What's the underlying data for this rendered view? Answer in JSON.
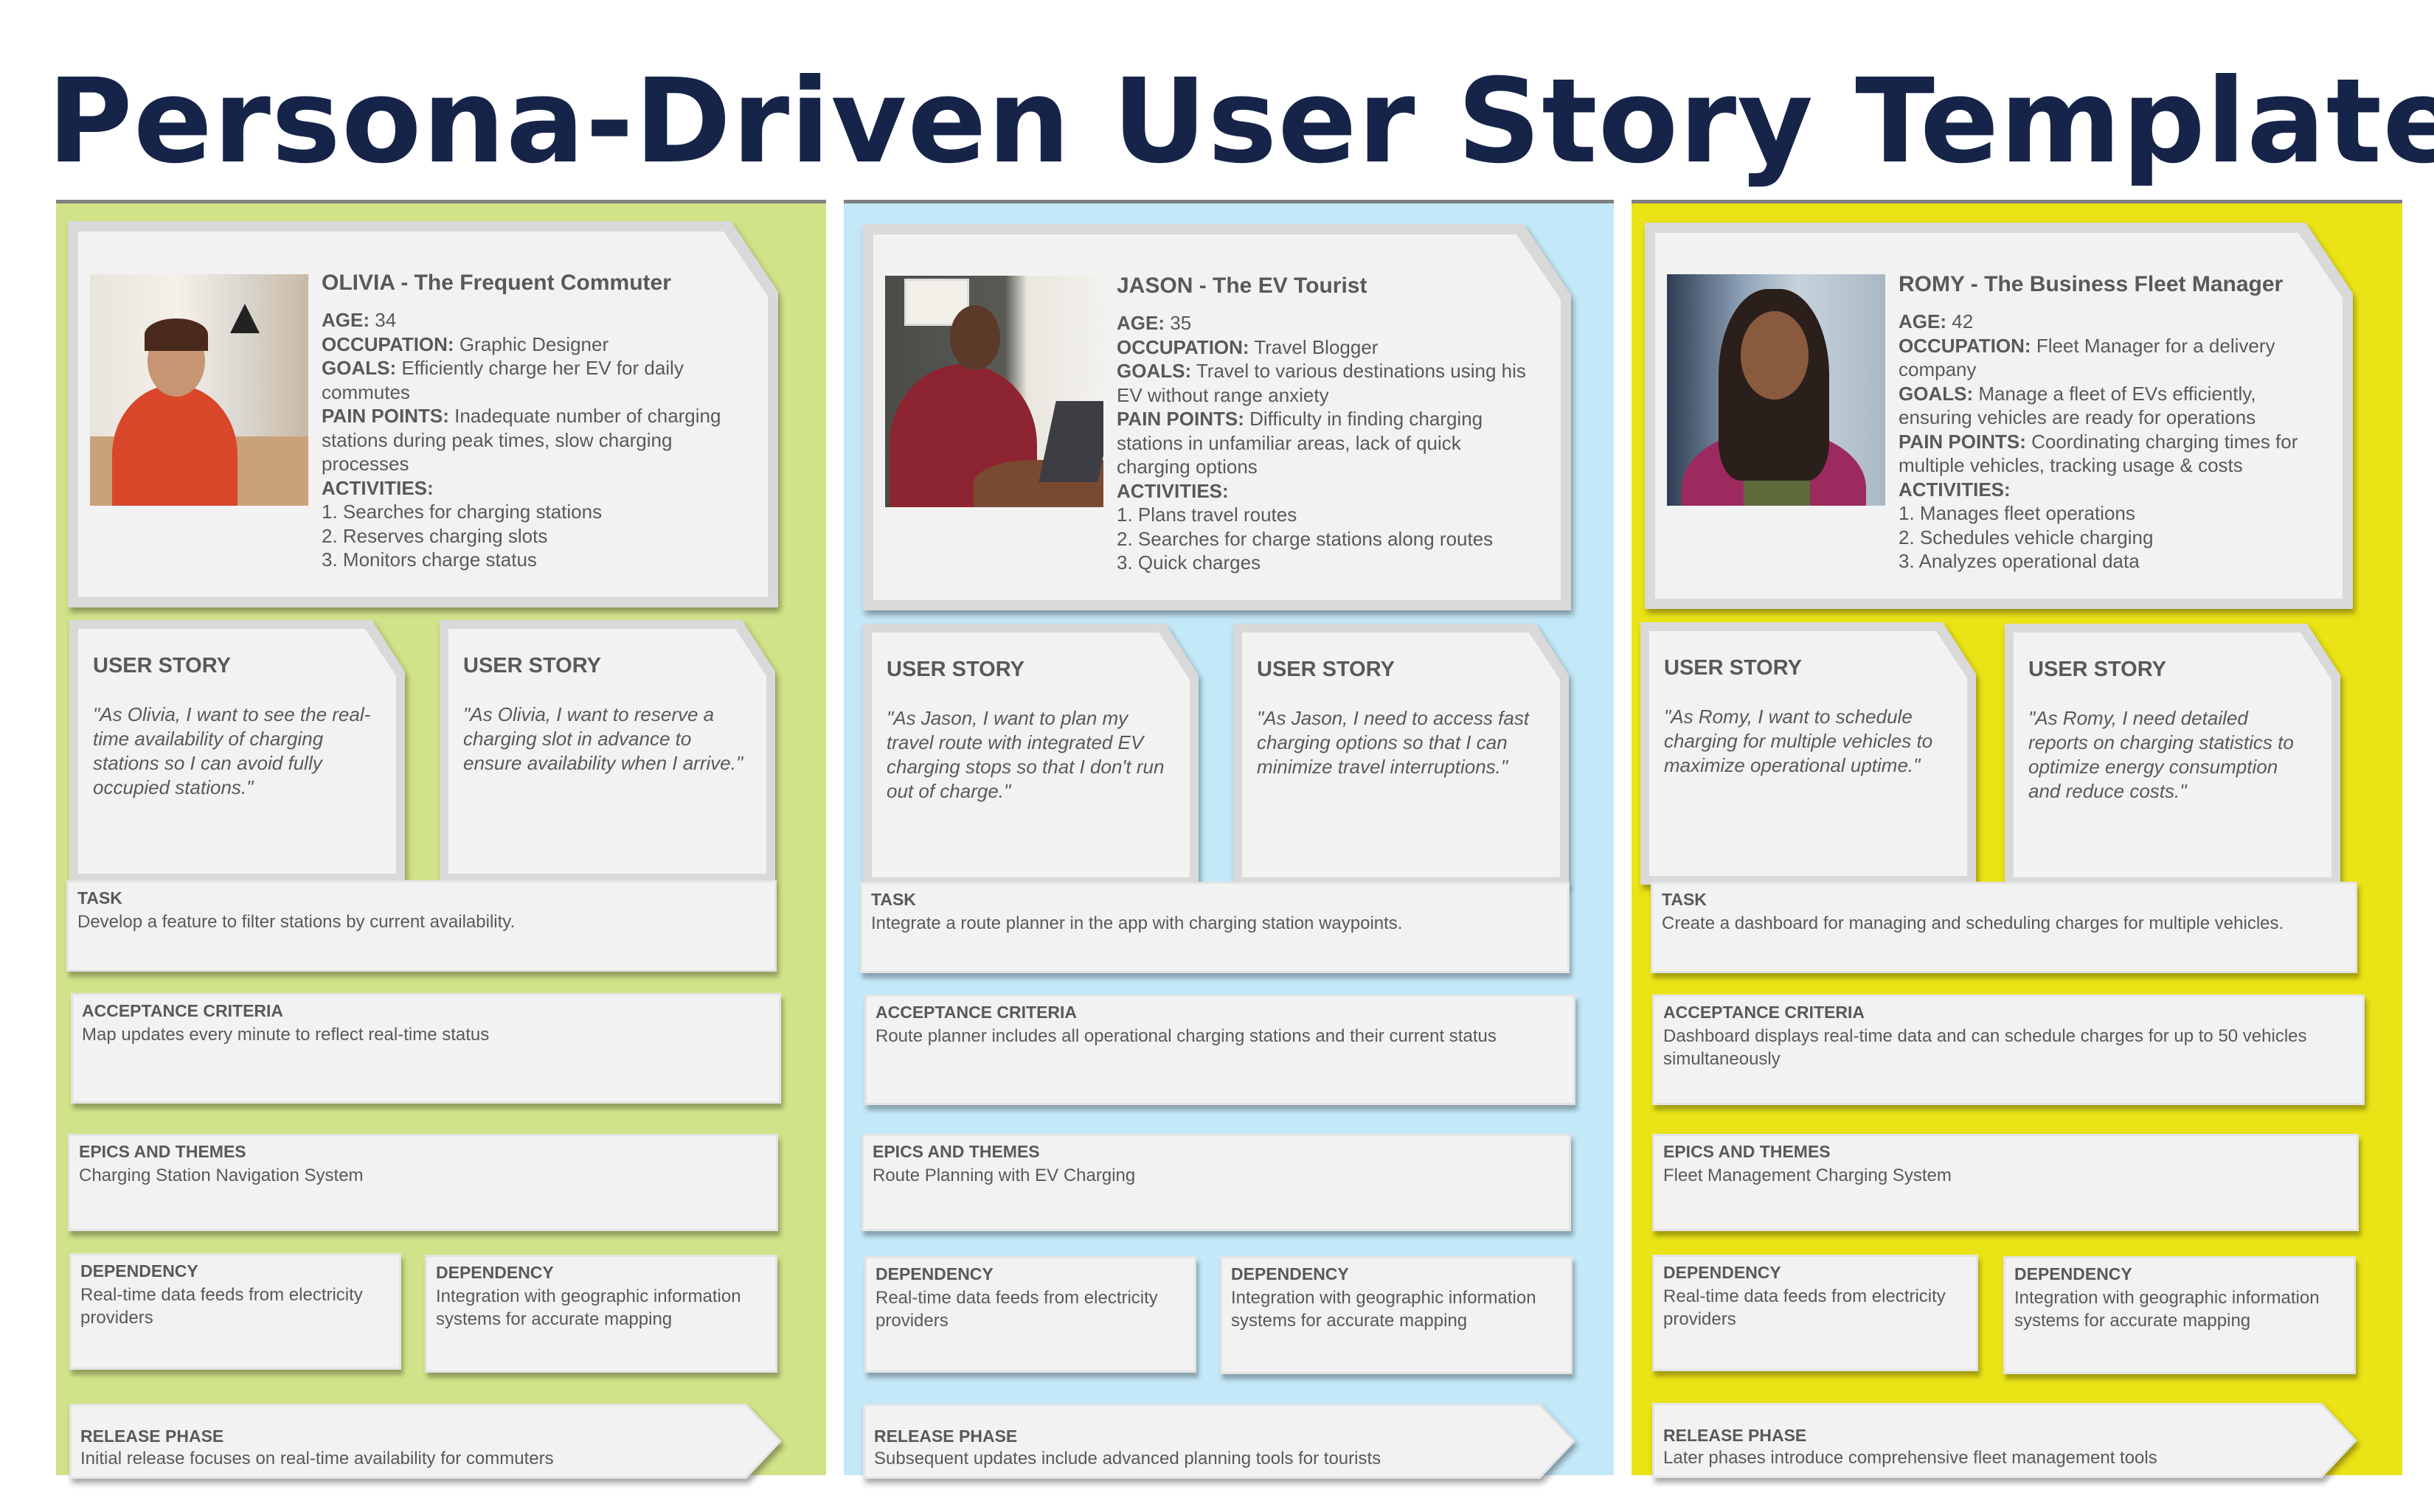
{
  "title": "Persona-Driven User Story Template",
  "colors": {
    "title": "#17244A",
    "columns": [
      "#D1E388",
      "#C3E8F8",
      "#EAE316"
    ],
    "card": "#F2F2F2",
    "card_border": "#D9D9D9",
    "text": "#595959"
  },
  "labels": {
    "age": "AGE:",
    "occupation": "OCCUPATION:",
    "goals": "GOALS:",
    "pain_points": "PAIN POINTS:",
    "activities": "ACTIVITIES:",
    "user_story": "USER STORY",
    "task": "TASK",
    "acceptance": "ACCEPTANCE CRITERIA",
    "epics": "EPICS AND THEMES",
    "dependency": "DEPENDENCY",
    "release": "RELEASE PHASE"
  },
  "personas": [
    {
      "name": "OLIVIA - The Frequent Commuter",
      "photo": "photo-of-smiling-woman-at-desk",
      "age": "34",
      "occupation": "Graphic Designer",
      "goals": "Efficiently charge her EV for daily commutes",
      "pain_points": "Inadequate number of charging stations during peak times, slow charging processes",
      "activities": [
        "1. Searches for charging stations",
        "2. Reserves charging slots",
        "3. Monitors charge status"
      ],
      "stories": [
        "\"As Olivia, I want to see the real-time availability of charging stations so I can avoid fully occupied stations.\"",
        "\"As Olivia, I want to reserve a charging slot in advance to ensure availability when I arrive.\""
      ],
      "task": "Develop a feature to filter stations by current availability.",
      "acceptance": "Map updates every minute to reflect real-time status",
      "epics": "Charging Station Navigation System",
      "dependencies": [
        "Real-time data feeds from electricity providers",
        "Integration with geographic information systems for accurate mapping"
      ],
      "release": "Initial release focuses on real-time availability for commuters"
    },
    {
      "name": "JASON - The EV Tourist",
      "photo": "photo-of-man-at-laptop",
      "age": "35",
      "occupation": "Travel Blogger",
      "goals": "Travel to various destinations using his EV without range anxiety",
      "pain_points": "Difficulty in finding charging stations in unfamiliar areas, lack of quick charging options",
      "activities": [
        "1. Plans travel routes",
        "2. Searches for charge stations along routes",
        "3. Quick charges"
      ],
      "stories": [
        "\"As Jason, I want to plan my travel route with integrated EV charging stops so that I don't run out of charge.\"",
        "\"As Jason, I need to access fast charging options so that I can minimize travel interruptions.\""
      ],
      "task": "Integrate a route planner in the app with charging station waypoints.",
      "acceptance": "Route planner includes all operational charging stations and their current status",
      "epics": "Route Planning with EV Charging",
      "dependencies": [
        "Real-time data feeds from electricity providers",
        "Integration with geographic information systems for accurate mapping"
      ],
      "release": "Subsequent updates include advanced planning tools for tourists"
    },
    {
      "name": "ROMY - The Business Fleet Manager",
      "photo": "photo-of-woman-with-braids",
      "age": "42",
      "occupation": "Fleet Manager for a delivery company",
      "goals": "Manage a fleet of EVs efficiently, ensuring vehicles are ready for operations",
      "pain_points": "Coordinating charging times for multiple vehicles, tracking usage & costs",
      "activities": [
        "1. Manages fleet operations",
        "2. Schedules vehicle charging",
        "3. Analyzes operational data"
      ],
      "stories": [
        "\"As Romy, I want to schedule charging for multiple vehicles to maximize operational uptime.\"",
        "\"As Romy, I need detailed reports on charging statistics to optimize energy consumption and reduce costs.\""
      ],
      "task": "Create a dashboard for managing and scheduling charges for multiple vehicles.",
      "acceptance": "Dashboard displays real-time data and can schedule charges for up to 50 vehicles simultaneously",
      "epics": "Fleet Management Charging System",
      "dependencies": [
        "Real-time data feeds from electricity providers",
        "Integration with geographic information systems for accurate mapping"
      ],
      "release": "Later phases introduce comprehensive fleet management tools"
    }
  ]
}
